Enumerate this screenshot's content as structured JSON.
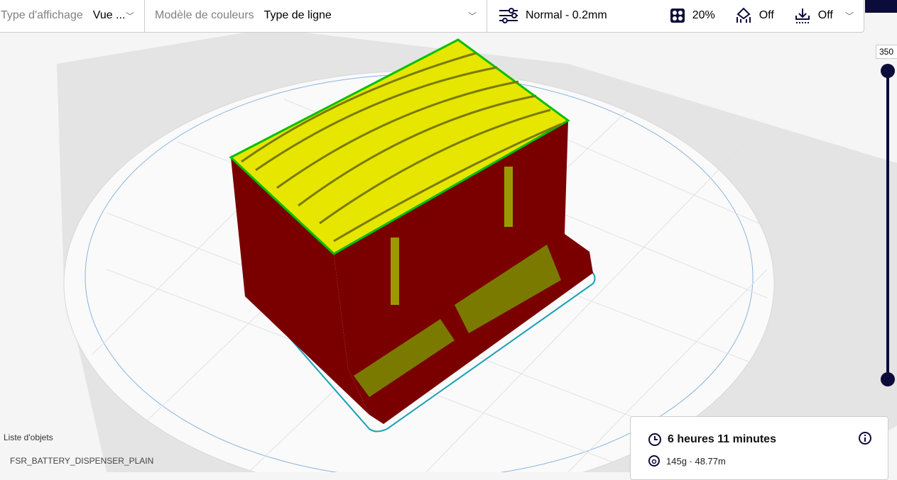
{
  "toolbar": {
    "view_type_label": "Type d'affichage",
    "view_type_value": "Vue ...",
    "color_scheme_label": "Modèle de couleurs",
    "color_scheme_value": "Type de ligne",
    "profile": "Normal - 0.2mm",
    "infill": "20%",
    "support": "Off",
    "adhesion": "Off"
  },
  "layer_slider": {
    "max_layer": "350",
    "top_fraction": 1.0,
    "bottom_fraction": 0.0
  },
  "object_list": {
    "title": "Liste d'objets",
    "object_name": "FSR_BATTERY_DISPENSER_PLAIN"
  },
  "print_info": {
    "time": "6 heures 11 minutes",
    "material": "145g · 48.77m"
  },
  "colors": {
    "accent": "#0c0c3a",
    "wall": "#7a0000",
    "skin": "#e6e600",
    "infill_dark": "#7a7a00",
    "inner_wall": "#00c000"
  }
}
